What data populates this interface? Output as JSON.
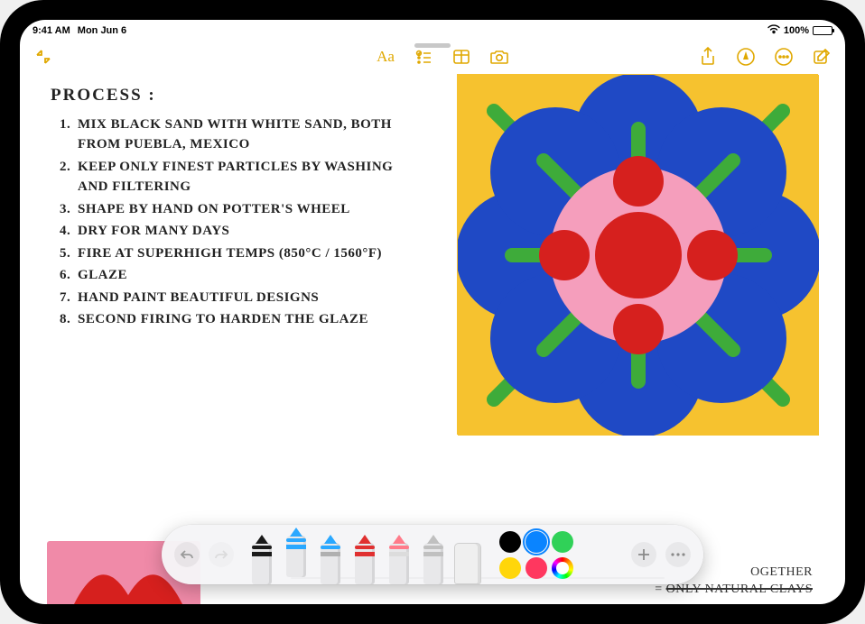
{
  "status": {
    "time": "9:41 AM",
    "date": "Mon Jun 6",
    "battery_pct": "100%",
    "wifi": "wifi-icon"
  },
  "toolbar": {
    "collapse": "collapse-icon",
    "format_text": "Aa",
    "checklist": "checklist-icon",
    "table": "table-icon",
    "camera": "camera-icon",
    "share": "share-icon",
    "lock": "drawing-lock-icon",
    "more": "more-icon",
    "compose": "compose-icon"
  },
  "note": {
    "title": "PROCESS :",
    "items": [
      "MIX BLACK SAND WITH WHITE SAND, BOTH FROM PUEBLA, MEXICO",
      "KEEP ONLY FINEST PARTICLES BY WASHING AND FILTERING",
      "SHAPE BY HAND ON POTTER'S WHEEL",
      "DRY FOR MANY DAYS",
      "FIRE AT SUPERHIGH TEMPS (850°C / 1560°F)",
      "GLAZE",
      "HAND PAINT BEAUTIFUL DESIGNS",
      "SECOND FIRING TO HARDEN THE GLAZE"
    ],
    "bottom_line_1": "OGETHER",
    "bottom_line_2": "ONLY NATURAL CLAYS"
  },
  "art": {
    "bg": "#f6c22f",
    "petal": "#1f49c5",
    "stem": "#3eab3a",
    "ring": "#f59ebc",
    "dot": "#d6201e"
  },
  "markup": {
    "undo": "undo-icon",
    "redo": "redo-icon",
    "add": "add-icon",
    "more": "ellipsis-icon",
    "tools": [
      {
        "name": "pen",
        "tip": "#1a1a1a",
        "band": "#1a1a1a",
        "selected": false
      },
      {
        "name": "marker",
        "tip": "#2aa8ff",
        "band": "#2aa8ff",
        "selected": true
      },
      {
        "name": "pencil",
        "tip": "#2aa8ff",
        "band": "#b0b0b0",
        "selected": false
      },
      {
        "name": "crayon",
        "tip": "#e03030",
        "band": "#e03030",
        "selected": false
      },
      {
        "name": "eraser",
        "tip": "#ff7b8a",
        "band": "#dcdcdc",
        "selected": false
      },
      {
        "name": "lasso",
        "tip": "#c0c0c0",
        "band": "#c0c0c0",
        "selected": false
      },
      {
        "name": "ruler",
        "tip": "#d8d8d8",
        "band": "#d8d8d8",
        "selected": false
      }
    ],
    "colors": [
      {
        "name": "black",
        "hex": "#000000"
      },
      {
        "name": "blue",
        "hex": "#0a84ff",
        "selected": true
      },
      {
        "name": "green",
        "hex": "#30d158"
      },
      {
        "name": "yellow",
        "hex": "#ffd60a"
      },
      {
        "name": "red",
        "hex": "#ff375f"
      },
      {
        "name": "picker",
        "hex": "rainbow"
      }
    ]
  }
}
